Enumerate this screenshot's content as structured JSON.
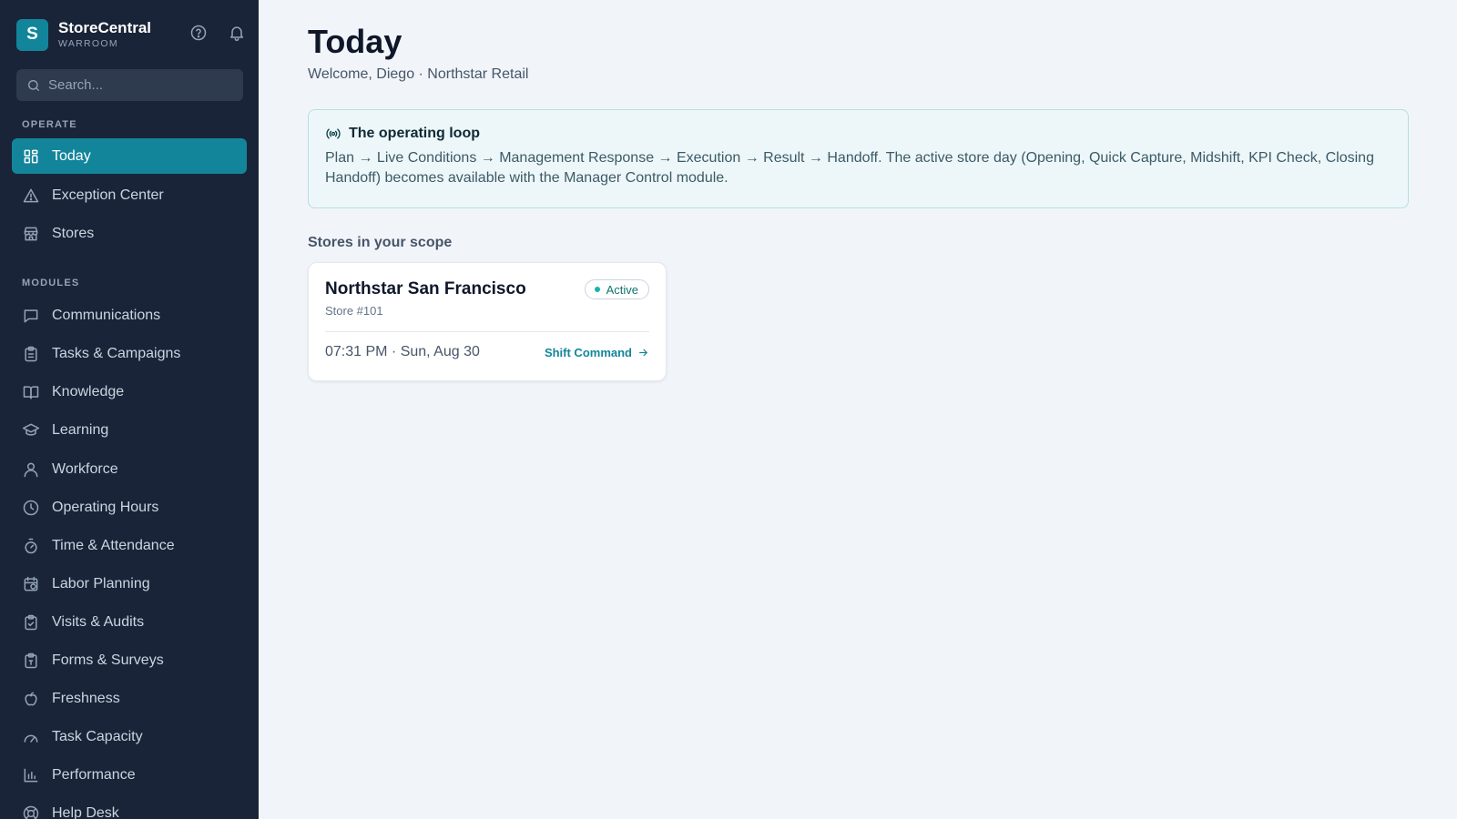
{
  "brand": {
    "logo_letter": "S",
    "name": "StoreCentral",
    "subtitle": "WARROOM"
  },
  "header_icons": [
    "help-circle-icon",
    "bell-icon"
  ],
  "search": {
    "placeholder": "Search...",
    "value": ""
  },
  "sidebar": {
    "sections": [
      {
        "label": "OPERATE",
        "items": [
          {
            "label": "Today",
            "icon": "dashboard-grid-icon",
            "active": true
          },
          {
            "label": "Exception Center",
            "icon": "warning-triangle-icon"
          },
          {
            "label": "Stores",
            "icon": "storefront-icon"
          }
        ]
      },
      {
        "label": "MODULES",
        "items": [
          {
            "label": "Communications",
            "icon": "chat-bubble-icon"
          },
          {
            "label": "Tasks & Campaigns",
            "icon": "clipboard-list-icon"
          },
          {
            "label": "Knowledge",
            "icon": "book-open-icon"
          },
          {
            "label": "Learning",
            "icon": "graduation-cap-icon"
          },
          {
            "label": "Workforce",
            "icon": "user-icon"
          },
          {
            "label": "Operating Hours",
            "icon": "clock-icon"
          },
          {
            "label": "Time & Attendance",
            "icon": "timer-icon"
          },
          {
            "label": "Labor Planning",
            "icon": "calendar-clock-icon"
          },
          {
            "label": "Visits & Audits",
            "icon": "clipboard-check-icon"
          },
          {
            "label": "Forms & Surveys",
            "icon": "clipboard-form-icon"
          },
          {
            "label": "Freshness",
            "icon": "apple-icon"
          },
          {
            "label": "Task Capacity",
            "icon": "gauge-icon"
          },
          {
            "label": "Performance",
            "icon": "bar-chart-icon"
          },
          {
            "label": "Help Desk",
            "icon": "lifebuoy-icon"
          }
        ]
      }
    ]
  },
  "page": {
    "title": "Today",
    "subtitle": "Welcome, Diego · Northstar Retail"
  },
  "operating_loop": {
    "icon": "broadcast-icon",
    "title": "The operating loop",
    "body": "Plan → Live Conditions → Management Response → Execution → Result → Handoff. The active store day (Opening, Quick Capture, Midshift, KPI Check, Closing Handoff) becomes available with the Manager Control module."
  },
  "stores_section": {
    "label": "Stores in your scope",
    "stores": [
      {
        "name": "Northstar San Francisco",
        "number": "Store #101",
        "status": "Active",
        "datetime": "07:31 PM · Sun, Aug 30",
        "action": "Shift Command"
      }
    ]
  },
  "colors": {
    "sidebar_bg": "#1a2438",
    "accent": "#12859b",
    "main_bg": "#f1f5f9",
    "info_bg": "#edf7f9",
    "status_dot": "#14b8a6"
  }
}
